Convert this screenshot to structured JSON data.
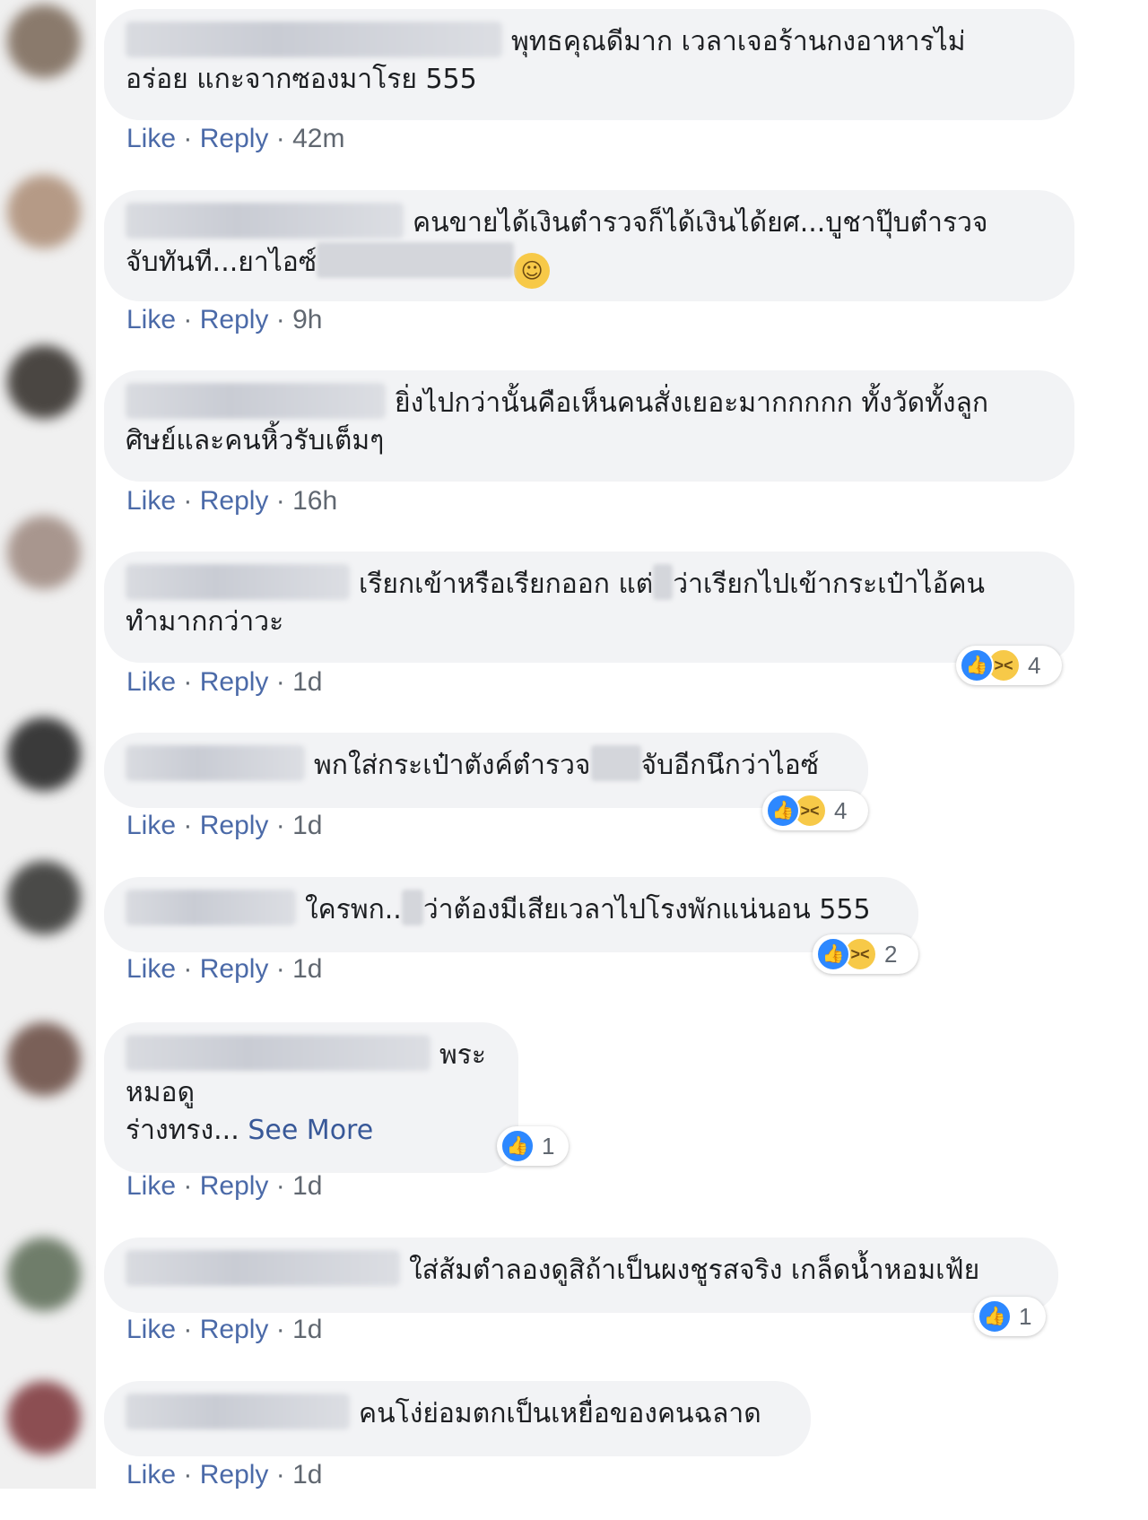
{
  "comments": [
    {
      "text_line1": "พุทธคุณดีมาก เวลาเจอร้านกงอาหารไม่",
      "text_line2": "อร่อย แกะจากซองมาโรย 555",
      "like": "Like",
      "reply": "Reply",
      "sep": "·",
      "time": "42m"
    },
    {
      "text_line1": "คนขายได้เงินตำรวจก็ได้เงินได้ยศ...บูชาปุ๊บตำรวจ",
      "text_line2": "จับทันที...ยาไอซ์",
      "like": "Like",
      "reply": "Reply",
      "sep": "·",
      "time": "9h",
      "emoji": "rolling-on-floor-laughing"
    },
    {
      "text_line1": "ยิ่งไปกว่านั้นคือเห็นคนสั่งเยอะมากกกกก ทั้งวัดทั้งลูก",
      "text_line2": "ศิษย์และคนหิ้วรับเต็มๆ",
      "like": "Like",
      "reply": "Reply",
      "sep": "·",
      "time": "16h"
    },
    {
      "text_line1a": "เรียกเข้าหรือเรียกออก แต่",
      "text_line1b": "ว่าเรียกไปเข้ากระเป๋าไอ้คน",
      "text_line2": "ทำมากกว่าวะ",
      "like": "Like",
      "reply": "Reply",
      "sep": "·",
      "time": "1d",
      "reaction_count": "4"
    },
    {
      "text_a": "พกใส่กระเป๋าตังค์ตำรวจ",
      "text_b": "จับอีกนึกว่าไอซ์",
      "like": "Like",
      "reply": "Reply",
      "sep": "·",
      "time": "1d",
      "reaction_count": "4"
    },
    {
      "text_a": "ใครพก..",
      "text_b": "ว่าต้องมีเสียเวลาไปโรงพักแน่นอน 555",
      "like": "Like",
      "reply": "Reply",
      "sep": "·",
      "time": "1d",
      "reaction_count": "2"
    },
    {
      "text_line1": "พระ",
      "text_line2": "หมอดู",
      "text_line3": "ร่างทรง...",
      "see_more": "See More",
      "like": "Like",
      "reply": "Reply",
      "sep": "·",
      "time": "1d",
      "reaction_count": "1"
    },
    {
      "text_line1": "ใส่ส้มตำลองดูสิถ้าเป็นผงชูรสจริง เกล็ดน้ำหอมเฟ้ย",
      "like": "Like",
      "reply": "Reply",
      "sep": "·",
      "time": "1d",
      "reaction_count": "1"
    },
    {
      "text_line1": "คนโง่ย่อมตกเป็นเหยื่อของคนฉลาด",
      "like": "Like",
      "reply": "Reply",
      "sep": "·",
      "time": "1d"
    }
  ],
  "colors": {
    "bubble": "#f2f3f5",
    "link": "#4b6aa8",
    "like_blue": "#2d88ff",
    "haha_yellow": "#f7c948"
  },
  "icons": {
    "like": "thumbs-up-icon",
    "haha": "laughing-face-icon"
  }
}
